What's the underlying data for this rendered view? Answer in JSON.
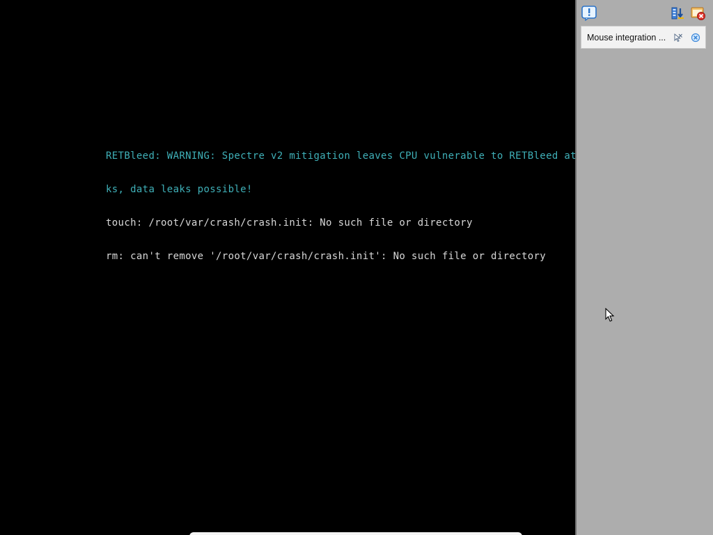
{
  "console": {
    "lines": [
      {
        "text": "RETBleed: WARNING: Spectre v2 mitigation leaves CPU vulnerable to RETBleed att",
        "style": "warn"
      },
      {
        "text": "ks, data leaks possible!",
        "style": "warn"
      },
      {
        "text": "touch: /root/var/crash/crash.init: No such file or directory",
        "style": "normal"
      },
      {
        "text": "rm: can't remove '/root/var/crash/crash.init': No such file or directory",
        "style": "normal"
      }
    ]
  },
  "side_panel": {
    "toolbar": {
      "icons": [
        "info-icon",
        "settings-icon",
        "close-icon"
      ]
    },
    "notification": {
      "text": "Mouse integration ...",
      "icons": [
        "mouse-integration-icon",
        "dismiss-icon"
      ]
    }
  },
  "colors": {
    "console_background": "#000000",
    "warning_text": "#3fb0b8",
    "normal_text": "#d8d8d8",
    "panel_background": "#adadad",
    "notification_background": "#f2f2f2"
  }
}
